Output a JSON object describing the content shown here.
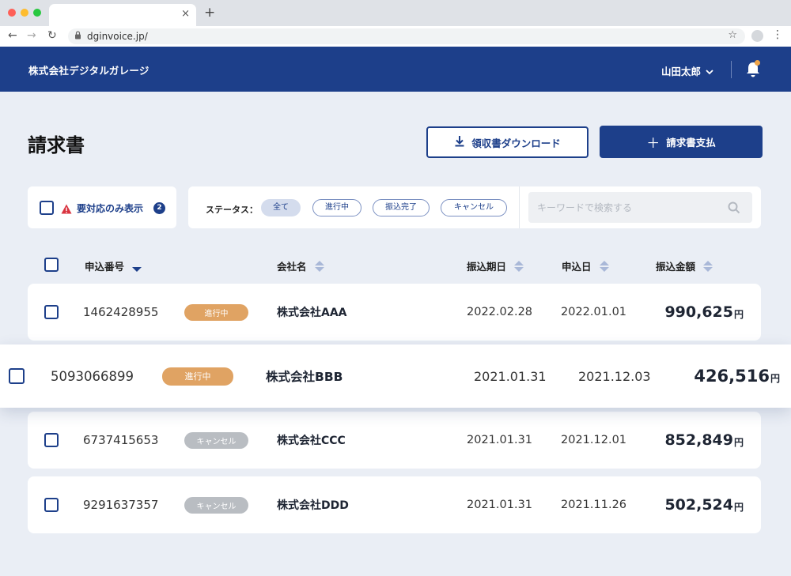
{
  "browser": {
    "url": "dginvoice.jp/",
    "traffic_light_colors": [
      "#fe5f57",
      "#febc2e",
      "#28c840"
    ]
  },
  "header": {
    "company": "株式会社デジタルガレージ",
    "user_name": "山田太郎",
    "notification_dot_color": "#f0a64a",
    "brand_color": "#1d3f8a"
  },
  "page": {
    "title": "請求書",
    "download_label": "領収書ダウンロード",
    "pay_label": "請求書支払"
  },
  "filters": {
    "needs_action_label": "要対応のみ表示",
    "needs_action_count": "2",
    "status_label": "ステータス：",
    "statuses": [
      "全て",
      "進行中",
      "振込完了",
      "キャンセル"
    ],
    "active_status": "全て",
    "search_placeholder": "キーワードで検索する"
  },
  "table": {
    "columns": [
      "申込番号",
      "会社名",
      "振込期日",
      "申込日",
      "振込金額"
    ],
    "currency_suffix": "円",
    "status_colors": {
      "進行中": "#e0a363",
      "キャンセル": "#b9bdc2"
    },
    "rows": [
      {
        "id": "1462428955",
        "status": "進行中",
        "company": "株式会社AAA",
        "due_date": "2022.02.28",
        "applied_date": "2022.01.01",
        "amount": "990,625"
      },
      {
        "id": "5093066899",
        "status": "進行中",
        "company": "株式会社BBB",
        "due_date": "2021.01.31",
        "applied_date": "2021.12.03",
        "amount": "426,516"
      },
      {
        "id": "6737415653",
        "status": "キャンセル",
        "company": "株式会社CCC",
        "due_date": "2021.01.31",
        "applied_date": "2021.12.01",
        "amount": "852,849"
      },
      {
        "id": "9291637357",
        "status": "キャンセル",
        "company": "株式会社DDD",
        "due_date": "2021.01.31",
        "applied_date": "2021.11.26",
        "amount": "502,524"
      }
    ]
  }
}
